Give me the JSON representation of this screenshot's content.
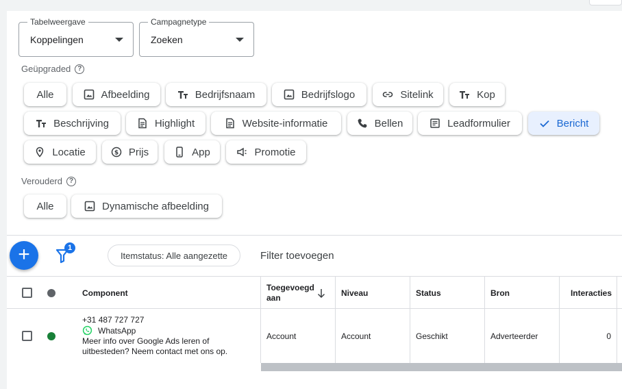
{
  "controls": {
    "table_view": {
      "label": "Tabelweergave",
      "value": "Koppelingen"
    },
    "campaign_type": {
      "label": "Campagnetype",
      "value": "Zoeken"
    }
  },
  "upgraded": {
    "title": "Geüpgraded",
    "chips": [
      {
        "label": "Alle",
        "icon": "",
        "selected": false
      },
      {
        "label": "Afbeelding",
        "icon": "image-icon",
        "selected": false
      },
      {
        "label": "Bedrijfsnaam",
        "icon": "text-icon",
        "selected": false
      },
      {
        "label": "Bedrijfslogo",
        "icon": "image-icon",
        "selected": false
      },
      {
        "label": "Sitelink",
        "icon": "link-icon",
        "selected": false
      },
      {
        "label": "Kop",
        "icon": "text-icon",
        "selected": false
      },
      {
        "label": "Beschrijving",
        "icon": "text-icon",
        "selected": false
      },
      {
        "label": "Highlight",
        "icon": "document-icon",
        "selected": false
      },
      {
        "label": "Website-informatie",
        "icon": "document-icon",
        "selected": false
      },
      {
        "label": "Bellen",
        "icon": "phone-icon",
        "selected": false
      },
      {
        "label": "Leadformulier",
        "icon": "form-icon",
        "selected": false
      },
      {
        "label": "Bericht",
        "icon": "check-icon",
        "selected": true
      },
      {
        "label": "Locatie",
        "icon": "location-pin-icon",
        "selected": false
      },
      {
        "label": "Prijs",
        "icon": "dollar-icon",
        "selected": false
      },
      {
        "label": "App",
        "icon": "phone-device-icon",
        "selected": false
      },
      {
        "label": "Promotie",
        "icon": "megaphone-icon",
        "selected": false
      }
    ]
  },
  "legacy": {
    "title": "Verouderd",
    "chips": [
      {
        "label": "Alle",
        "icon": ""
      },
      {
        "label": "Dynamische afbeelding",
        "icon": "image-icon"
      }
    ]
  },
  "toolbar": {
    "add_label": "+",
    "filter_badge": "1",
    "status_filter": "Itemstatus: Alle aangezette",
    "add_filter": "Filter toevoegen"
  },
  "table": {
    "columns": [
      "Component",
      "Toegevoegd aan",
      "Niveau",
      "Status",
      "Bron",
      "Interacties"
    ],
    "rows": [
      {
        "component_phone": "+31 487 727 727",
        "component_app": "WhatsApp",
        "component_text": "Meer info over Google Ads leren of uitbesteden? Neem contact met ons op.",
        "added_to": "Account",
        "level": "Account",
        "status": "Geschikt",
        "source": "Adverteerder",
        "interactions": "0",
        "status_color": "#188038"
      }
    ]
  },
  "colors": {
    "accent": "#1a73e8",
    "selected_chip_bg": "#e8f0fe",
    "whatsapp": "#25d366"
  }
}
